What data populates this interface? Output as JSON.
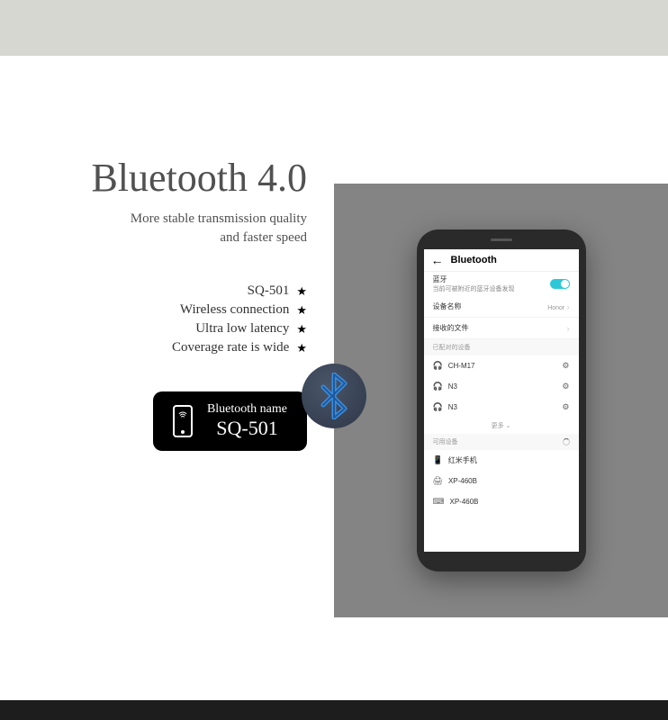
{
  "heading": "Bluetooth 4.0",
  "subtitle_line1": "More stable transmission quality",
  "subtitle_line2": "and faster speed",
  "features": [
    "SQ-501",
    "Wireless connection",
    "Ultra low latency",
    "Coverage rate is wide"
  ],
  "badge": {
    "label": "Bluetooth name",
    "name": "SQ-501"
  },
  "phone_screen": {
    "title": "Bluetooth",
    "bt_toggle_label": "蓝牙",
    "bt_toggle_sublabel": "当前可被附近的蓝牙设备发现",
    "rows": [
      {
        "label": "设备名称",
        "value": "Honor"
      },
      {
        "label": "接收的文件",
        "value": ""
      }
    ],
    "paired_label": "已配对的设备",
    "paired_devices": [
      {
        "name": "CH-M17",
        "icon": "headphones"
      },
      {
        "name": "N3",
        "icon": "headphones"
      },
      {
        "name": "N3",
        "icon": "headphones"
      }
    ],
    "more_label": "更多",
    "available_label": "可用设备",
    "available_devices": [
      {
        "name": "红米手机",
        "icon": "phone"
      },
      {
        "name": "XP-460B",
        "icon": "printer"
      },
      {
        "name": "XP-460B",
        "icon": "bluetooth"
      }
    ]
  }
}
